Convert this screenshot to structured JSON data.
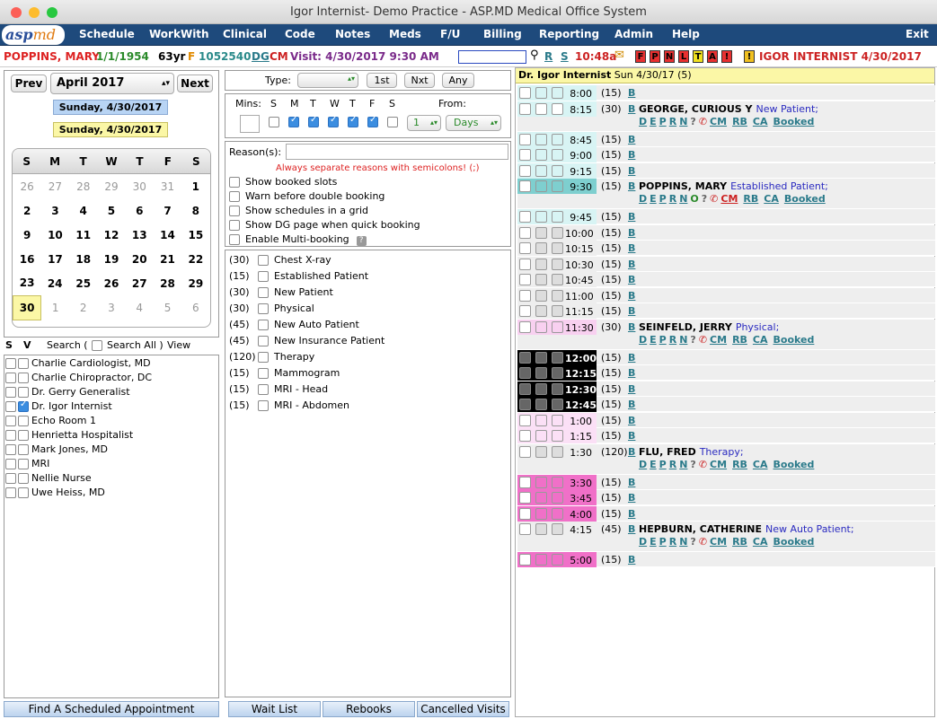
{
  "window": {
    "title": "Igor Internist- Demo Practice - ASP.MD Medical Office System"
  },
  "menu": {
    "items": [
      "Schedule",
      "WorkWith",
      "Clinical",
      "Code",
      "Notes",
      "Meds",
      "F/U",
      "Billing",
      "Reporting",
      "Admin",
      "Help"
    ],
    "exit": "Exit",
    "logo": "asp",
    "logo2": "md"
  },
  "patient": {
    "name": "POPPINS, MARY",
    "dob": "1/1/1954",
    "age": "63yr",
    "sex": "F",
    "id": "1052540",
    "dg": "DG",
    "cm": "CM",
    "visit": "Visit: 4/30/2017 9:30 AM",
    "r": "R",
    "s": "S",
    "time": "10:48a",
    "flags": [
      "F",
      "P",
      "N",
      "L",
      "T",
      "A",
      "!",
      "!"
    ],
    "provider": "IGOR INTERNIST 4/30/2017"
  },
  "calendar": {
    "prev": "Prev",
    "month": "April 2017",
    "next": "Next",
    "date1": "Sunday, 4/30/2017",
    "date2": "Sunday, 4/30/2017",
    "days": [
      "S",
      "M",
      "T",
      "W",
      "T",
      "F",
      "S"
    ],
    "weeks": [
      [
        "26",
        "27",
        "28",
        "29",
        "30",
        "31",
        "1"
      ],
      [
        "2",
        "3",
        "4",
        "5",
        "6",
        "7",
        "8"
      ],
      [
        "9",
        "10",
        "11",
        "12",
        "13",
        "14",
        "15"
      ],
      [
        "16",
        "17",
        "18",
        "19",
        "20",
        "21",
        "22"
      ],
      [
        "23",
        "24",
        "25",
        "26",
        "27",
        "28",
        "29"
      ],
      [
        "30",
        "1",
        "2",
        "3",
        "4",
        "5",
        "6"
      ]
    ]
  },
  "resources": {
    "s": "S",
    "v": "V",
    "search": "Search (",
    "search_all": "Search All )",
    "view": "View",
    "items": [
      "Charlie Cardiologist, MD",
      "Charlie Chiropractor, DC",
      "Dr. Gerry Generalist",
      "Dr. Igor Internist",
      "Echo Room 1",
      "Henrietta Hospitalist",
      "Mark Jones, MD",
      "MRI",
      "Nellie Nurse",
      "Uwe Heiss, MD"
    ],
    "checked": 3
  },
  "find_button": "Find A Scheduled Appointment",
  "filters": {
    "type": "Type:",
    "first": "1st",
    "next": "Nxt",
    "any": "Any",
    "mins": "Mins:",
    "days": [
      "S",
      "M",
      "T",
      "W",
      "T",
      "F",
      "S"
    ],
    "from": "From:",
    "from_num": "1",
    "from_unit": "Days"
  },
  "options": {
    "reasons": "Reason(s):",
    "warning": "Always separate reasons with semicolons! (;)",
    "items": [
      "Show booked slots",
      "Warn before double booking",
      "Show schedules in a grid",
      "Show DG page when quick booking",
      "Enable Multi-booking"
    ],
    "help": "?"
  },
  "appt_types": [
    [
      "(30)",
      "Chest X-ray"
    ],
    [
      "(15)",
      "Established Patient"
    ],
    [
      "(30)",
      "New Patient"
    ],
    [
      "(30)",
      "Physical"
    ],
    [
      "(45)",
      "New Auto Patient"
    ],
    [
      "(45)",
      "New Insurance Patient"
    ],
    [
      "(120)",
      "Therapy"
    ],
    [
      "(15)",
      "Mammogram"
    ],
    [
      "(15)",
      "MRI - Head"
    ],
    [
      "(15)",
      "MRI - Abdomen"
    ]
  ],
  "bottom_buttons": [
    "Wait List",
    "Rebooks",
    "Cancelled Visits"
  ],
  "schedule": {
    "header": "Dr. Igor Internist",
    "header_date": "Sun 4/30/17 (5)",
    "b": "B",
    "links": [
      "D",
      "E",
      "P",
      "R",
      "N"
    ],
    "q": "?",
    "o": "O",
    "cm": "CM",
    "rb": "RB",
    "ca": "CA",
    "booked": "Booked",
    "slots": [
      {
        "t": "8:00",
        "d": "(15)"
      },
      {
        "t": "8:15",
        "d": "(30)",
        "name": "GEORGE, CURIOUS Y",
        "type": "New Patient;"
      },
      {
        "t": "8:45",
        "d": "(15)"
      },
      {
        "t": "9:00",
        "d": "(15)"
      },
      {
        "t": "9:15",
        "d": "(15)"
      },
      {
        "t": "9:30",
        "d": "(15)",
        "name": "POPPINS, MARY",
        "type": "Established Patient;"
      },
      {
        "t": "9:45",
        "d": "(15)"
      },
      {
        "t": "10:00",
        "d": "(15)"
      },
      {
        "t": "10:15",
        "d": "(15)"
      },
      {
        "t": "10:30",
        "d": "(15)"
      },
      {
        "t": "10:45",
        "d": "(15)"
      },
      {
        "t": "11:00",
        "d": "(15)"
      },
      {
        "t": "11:15",
        "d": "(15)"
      },
      {
        "t": "11:30",
        "d": "(30)",
        "name": "SEINFELD, JERRY",
        "type": "Physical;"
      },
      {
        "t": "12:00",
        "d": "(15)"
      },
      {
        "t": "12:15",
        "d": "(15)"
      },
      {
        "t": "12:30",
        "d": "(15)"
      },
      {
        "t": "12:45",
        "d": "(15)"
      },
      {
        "t": "1:00",
        "d": "(15)"
      },
      {
        "t": "1:15",
        "d": "(15)"
      },
      {
        "t": "1:30",
        "d": "(120)",
        "name": "FLU, FRED",
        "type": "Therapy;"
      },
      {
        "t": "3:30",
        "d": "(15)"
      },
      {
        "t": "3:45",
        "d": "(15)"
      },
      {
        "t": "4:00",
        "d": "(15)"
      },
      {
        "t": "4:15",
        "d": "(45)",
        "name": "HEPBURN, CATHERINE",
        "type": "New Auto Patient;"
      },
      {
        "t": "5:00",
        "d": "(15)"
      }
    ]
  }
}
